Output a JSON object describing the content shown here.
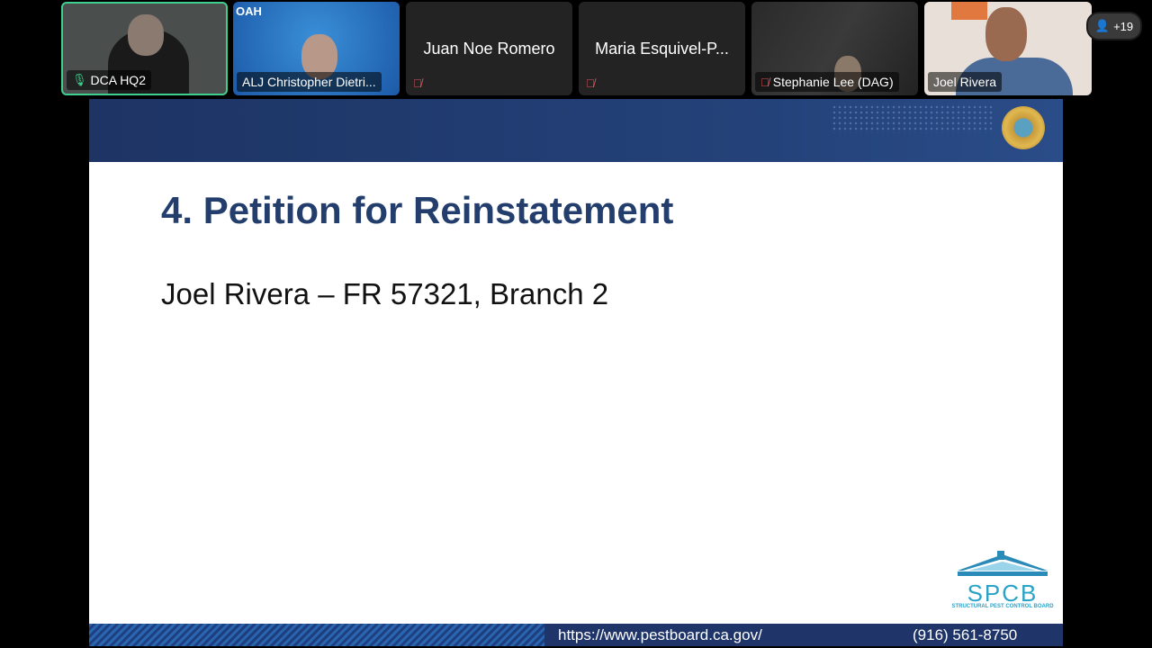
{
  "participants": [
    {
      "name": "DCA HQ2",
      "mic": "on",
      "active": true
    },
    {
      "name": "ALJ Christopher Dietri...",
      "label": "OAH",
      "mic": "none"
    },
    {
      "name": "Juan Noe Romero",
      "mic": "off"
    },
    {
      "name": "Maria Esquivel-P...",
      "mic": "off"
    },
    {
      "name": "Stephanie Lee (DAG)",
      "mic": "off"
    },
    {
      "name": "Joel Rivera",
      "mic": "none"
    }
  ],
  "more_participants": "+19",
  "slide": {
    "title": "4. Petition for Reinstatement",
    "subtitle": "Joel Rivera – FR 57321, Branch 2",
    "footer_url": "https://www.pestboard.ca.gov/",
    "footer_phone": "(916) 561-8750",
    "logo_text": "SPCB",
    "logo_subtext": "STRUCTURAL PEST CONTROL BOARD"
  },
  "colors": {
    "active_border": "#3ecf8e",
    "navy": "#1f3468",
    "title": "#233e6c",
    "logo": "#2aa3c8"
  }
}
